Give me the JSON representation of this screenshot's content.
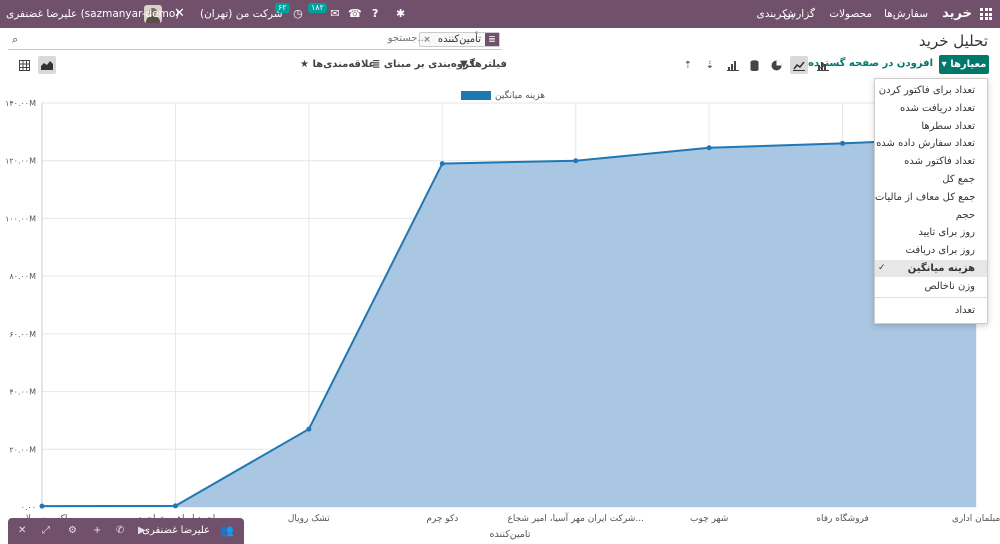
{
  "topbar": {
    "brand": "خرید",
    "menus": [
      "سفارش‌ها",
      "محصولات",
      "گزارش",
      "پیکربندی"
    ],
    "company": "شرکت من (تهران)",
    "activity_count": "۶۲",
    "message_count": "۱۸۲",
    "user": "علیرضا غضنفری (sazmanyar-demo)"
  },
  "page": {
    "title": "تحلیل خرید"
  },
  "search": {
    "facet_value": "تأمین‌کننده",
    "placeholder": "جستجو..."
  },
  "toolbar": {
    "measures": "معیارها",
    "insert": "افزودن در صفحه گسترده",
    "filters": "فیلترها",
    "groupby": "گروه‌بندی بر مبنای",
    "favorites": "علاقه‌مندی‌ها"
  },
  "measures_menu": {
    "items": [
      "تعداد برای فاکتور کردن",
      "تعداد دریافت شده",
      "تعداد سطرها",
      "تعداد سفارش داده شده",
      "تعداد فاکتور شده",
      "جمع کل",
      "جمع کل معاف از مالیات",
      "حجم",
      "روز برای تایید",
      "روز برای دریافت",
      "هزینه میانگین",
      "وزن ناخالص"
    ],
    "selected": "هزینه میانگین",
    "count_item": "تعداد"
  },
  "chat": {
    "name": "علیرضا غضنفری"
  },
  "chart_data": {
    "type": "area",
    "legend": [
      "هزینه میانگین"
    ],
    "legend_position": "top-center",
    "series_color": "#1f77b4",
    "fill_color": "#a9c6e2",
    "xlabel": "تامین‌کننده",
    "ylabel": "",
    "y_ticks": [
      "۰.۰۰",
      "۲۰.۰۰M",
      "۴۰.۰۰M",
      "۶۰.۰۰M",
      "۸۰.۰۰M",
      "۱۰۰.۰۰M",
      "۱۲۰.۰۰M",
      "۱۴۰.۰۰M"
    ],
    "ylim": [
      0,
      140000000
    ],
    "grid": true,
    "categories": [
      "مبلمان اداری",
      "فروشگاه رفاه",
      "شهر چوب",
      "شرکت ایران مهر آسیا، امیر شجاع...",
      "دکو چرم",
      "تشک رویال",
      "احمد ابراهیم خواجه‌ی",
      "اکسپرس لاین"
    ],
    "values": [
      128000000,
      126000000,
      124500000,
      120000000,
      119000000,
      27000000,
      400000,
      300000
    ]
  }
}
